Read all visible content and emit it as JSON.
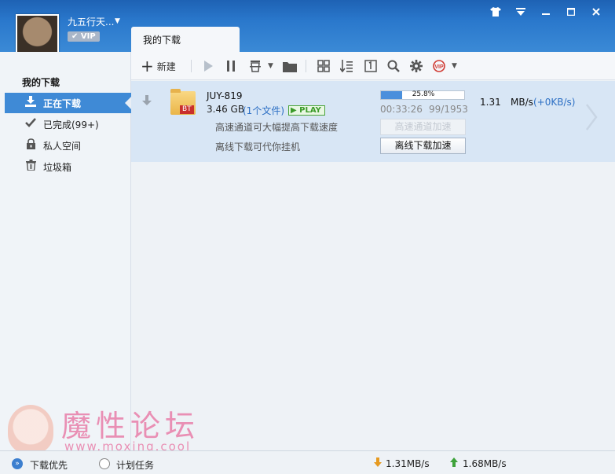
{
  "user": {
    "name": "九五行天...",
    "vip_label": "VIP"
  },
  "tab": {
    "label": "我的下载"
  },
  "toolbar": {
    "new_label": "新建"
  },
  "sidebar": {
    "heading": "我的下载",
    "items": [
      {
        "label": "正在下载",
        "icon": "download-icon"
      },
      {
        "label": "已完成(99+)",
        "icon": "check-icon"
      },
      {
        "label": "私人空间",
        "icon": "lock-icon"
      },
      {
        "label": "垃圾箱",
        "icon": "trash-icon"
      }
    ]
  },
  "task": {
    "name": "JUY-819",
    "size": "3.46 GB",
    "files": "(1个文件)",
    "play_label": "PLAY",
    "type_tag": "BT",
    "hint_high_speed": "高速通道可大幅提高下载速度",
    "hint_offline": "离线下载可代你挂机",
    "progress_text": "25.8%",
    "progress_value": 25.8,
    "elapsed": "00:33:26",
    "pieces": "99/1953",
    "btn_high_speed": "高速通道加速",
    "btn_offline": "离线下载加速",
    "speed": "1.31",
    "speed_unit": "MB/s",
    "speed_extra": "(+0KB/s)"
  },
  "statusbar": {
    "priority_label": "下载优先",
    "plan_label": "计划任务",
    "down_speed": "1.31MB/s",
    "up_speed": "1.68MB/s"
  },
  "watermark": {
    "title": "魔性论坛",
    "url": "www.moxing.cool"
  },
  "colors": {
    "accent": "#3f8ad6",
    "titlebar": "#2a78cc",
    "link": "#2c6fc4"
  }
}
